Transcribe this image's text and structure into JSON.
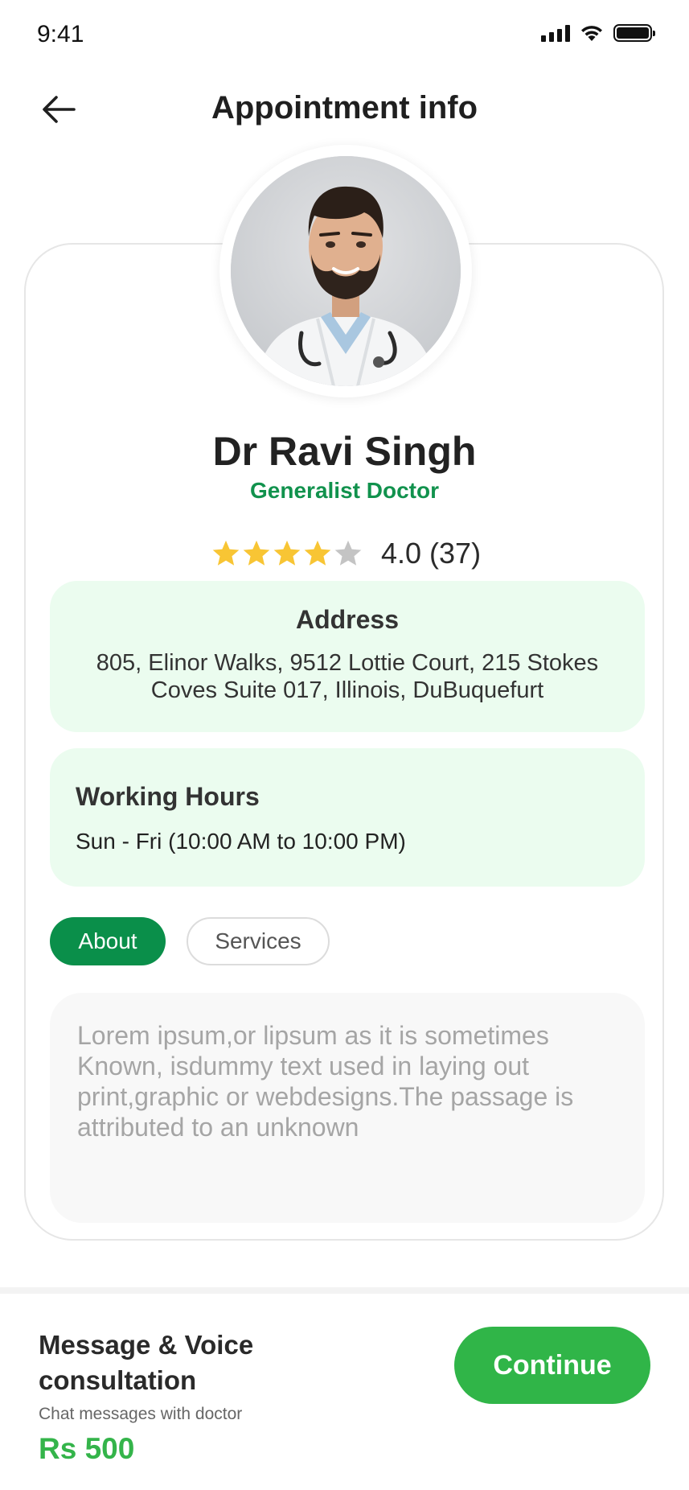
{
  "status_bar": {
    "time": "9:41",
    "icons": [
      "signal-icon",
      "wifi-icon",
      "battery-icon"
    ]
  },
  "header": {
    "title": "Appointment info",
    "back_icon": "arrow-left-icon"
  },
  "doctor": {
    "name": "Dr Ravi Singh",
    "specialty": "Generalist Doctor",
    "rating_value": 4.0,
    "rating_text": "4.0 (37)",
    "rating_max": 5
  },
  "address": {
    "title": "Address",
    "text": "805, Elinor Walks, 9512 Lottie Court, 215 Stokes Coves Suite 017, Illinois, DuBuquefurt"
  },
  "working_hours": {
    "title": "Working Hours",
    "text": "Sun - Fri (10:00 AM to 10:00 PM)"
  },
  "tabs": [
    {
      "label": "About",
      "active": true
    },
    {
      "label": "Services",
      "active": false
    }
  ],
  "about": {
    "text": "Lorem ipsum,or lipsum as it is sometimes Known, isdummy text used in laying out print,graphic or webdesigns.The passage is attributed to an unknown"
  },
  "consultation": {
    "title": "Message & Voice consultation",
    "subtitle": "Chat messages with doctor",
    "price": "Rs 500",
    "button_label": "Continue"
  },
  "colors": {
    "accent_green": "#30b548",
    "dark_green": "#0a8f4a",
    "specialty_green": "#11924d",
    "mint_bg": "#ebfcef",
    "star_yellow": "#f8c534",
    "star_gray": "#c4c4c4"
  }
}
